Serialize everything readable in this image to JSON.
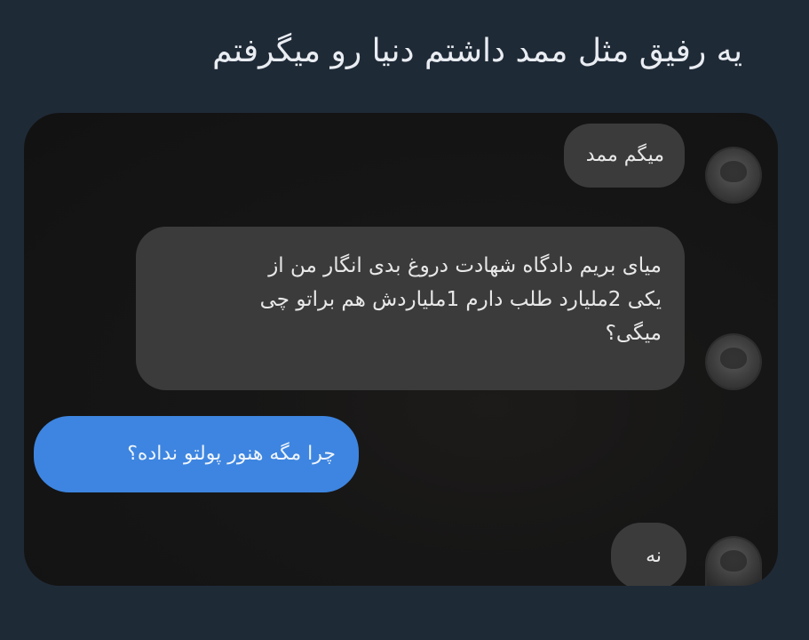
{
  "caption": "یه رفیق مثل ممد داشتم دنیا رو میگرفتم",
  "conversation": {
    "messages": [
      {
        "direction": "incoming",
        "text": "میگم ممد"
      },
      {
        "direction": "incoming",
        "lines": [
          "میای بریم دادگاه شهادت دروغ بدی انگار من از",
          "یکی 2ملیارد طلب دارم 1ملیاردش هم براتو چی",
          "میگی؟"
        ]
      },
      {
        "direction": "outgoing",
        "text": "چرا مگه هنور پولتو نداده؟"
      },
      {
        "direction": "incoming",
        "text": "نه"
      }
    ]
  },
  "colors": {
    "page_background": "#1f2a37",
    "chat_background": "#141414",
    "incoming_bubble": "#3b3b3b",
    "outgoing_bubble": "#3d85e0"
  }
}
